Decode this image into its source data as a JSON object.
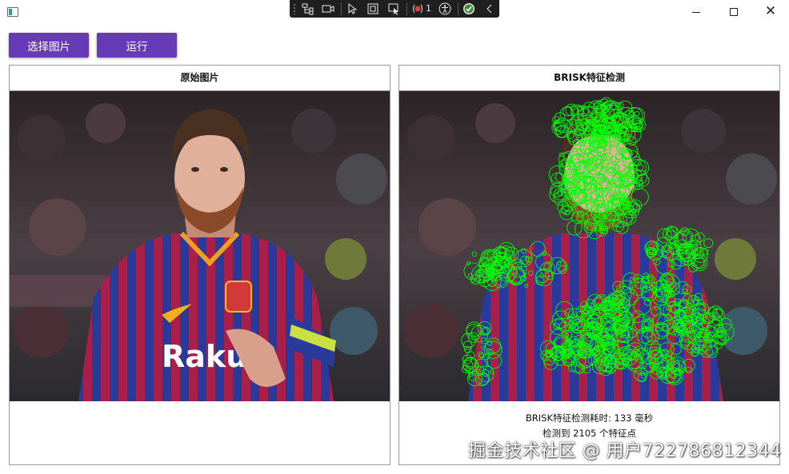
{
  "toolbar": {
    "select_image_label": "选择图片",
    "run_label": "运行",
    "accent_color": "#673ab7"
  },
  "devtools": {
    "binding_error_count": "1"
  },
  "panels": {
    "original": {
      "title": "原始图片"
    },
    "brisk": {
      "title": "BRISK特征检测",
      "time_text": "BRISK特征检测耗时: 133 毫秒",
      "count_text": "检测到 2105 个特征点",
      "keypoint_color": "#00ff00"
    }
  },
  "watermark": "掘金技术社区 @ 用户722786812344"
}
